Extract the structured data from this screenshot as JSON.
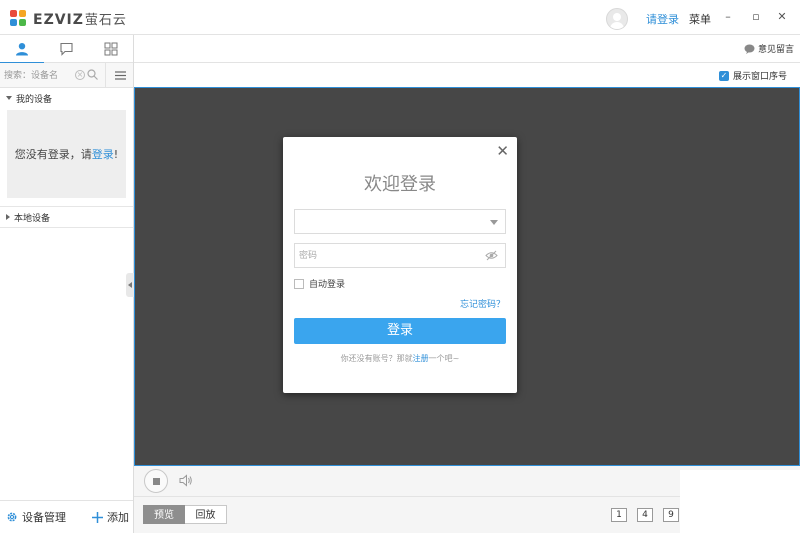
{
  "app": {
    "logo_text": "EZVIZ",
    "logo_cn": "萤石云",
    "login_link": "请登录",
    "menu_label": "菜单",
    "win_min": "–",
    "win_max": "▫",
    "win_close": "✕"
  },
  "sidebar": {
    "tabs": [
      "user-icon",
      "chat-icon",
      "grid-icon"
    ],
    "search_placeholder": "搜索：设备名",
    "my_devices_label": "我的设备",
    "not_logged_text": "您没有登录，请",
    "not_logged_link": "登录",
    "not_logged_suffix": "!",
    "local_devices_label": "本地设备",
    "device_mgmt_label": "设备管理",
    "add_label": "添加"
  },
  "toolbar": {
    "feedback_label": "意见留言",
    "show_window_number_label": "展示窗口序号",
    "show_window_number_checked": true
  },
  "playback": {
    "preview_label": "预览",
    "playback_label": "回放",
    "layouts": [
      "1",
      "4",
      "9"
    ]
  },
  "login_dialog": {
    "title": "欢迎登录",
    "account_value": "",
    "password_placeholder": "密码",
    "auto_login_label": "自动登录",
    "forgot_password": "忘记密码？",
    "submit_label": "登录",
    "register_prefix": "你还没有账号？那就",
    "register_link": "注册",
    "register_suffix": "一个吧~"
  },
  "colors": {
    "accent": "#2f8fd8",
    "submit": "#3aa5ee",
    "viewer_bg": "#474747"
  }
}
